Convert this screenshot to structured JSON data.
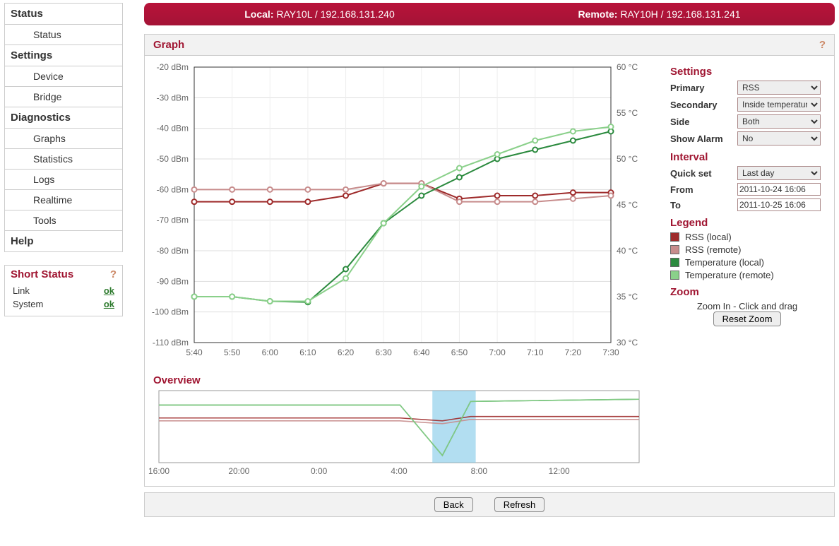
{
  "header": {
    "local_label": "Local:",
    "local_value": "RAY10L / 192.168.131.240",
    "remote_label": "Remote:",
    "remote_value": "RAY10H / 192.168.131.241"
  },
  "menu": {
    "groups": [
      {
        "title": "Status",
        "items": [
          "Status"
        ]
      },
      {
        "title": "Settings",
        "items": [
          "Device",
          "Bridge"
        ]
      },
      {
        "title": "Diagnostics",
        "items": [
          "Graphs",
          "Statistics",
          "Logs",
          "Realtime",
          "Tools"
        ]
      },
      {
        "title": "Help",
        "items": []
      }
    ]
  },
  "short_status": {
    "title": "Short Status",
    "help": "?",
    "rows": [
      {
        "label": "Link",
        "value": "ok"
      },
      {
        "label": "System",
        "value": "ok"
      }
    ]
  },
  "panel": {
    "title": "Graph",
    "help": "?"
  },
  "overview": {
    "title": "Overview"
  },
  "settings": {
    "title": "Settings",
    "primary": {
      "label": "Primary",
      "value": "RSS"
    },
    "secondary": {
      "label": "Secondary",
      "value": "Inside temperature"
    },
    "side": {
      "label": "Side",
      "value": "Both"
    },
    "alarm": {
      "label": "Show Alarm",
      "value": "No"
    }
  },
  "interval": {
    "title": "Interval",
    "quickset": {
      "label": "Quick set",
      "value": "Last day"
    },
    "from": {
      "label": "From",
      "value": "2011-10-24 16:06"
    },
    "to": {
      "label": "To",
      "value": "2011-10-25 16:06"
    }
  },
  "legend": {
    "title": "Legend",
    "items": [
      {
        "label": "RSS (local)",
        "color": "#9e2b2b"
      },
      {
        "label": "RSS (remote)",
        "color": "#c78c8c"
      },
      {
        "label": "Temperature (local)",
        "color": "#2b8a3e"
      },
      {
        "label": "Temperature (remote)",
        "color": "#8ad08a"
      }
    ]
  },
  "zoom": {
    "title": "Zoom",
    "hint": "Zoom In - Click and drag",
    "reset": "Reset Zoom"
  },
  "footer": {
    "back": "Back",
    "refresh": "Refresh"
  },
  "chart_data": {
    "type": "line",
    "title": "",
    "x": [
      "5:40",
      "5:50",
      "6:00",
      "6:10",
      "6:20",
      "6:30",
      "6:40",
      "6:50",
      "7:00",
      "7:10",
      "7:20",
      "7:30"
    ],
    "y1": {
      "label": "dBm",
      "min": -110,
      "max": -20,
      "ticks": [
        -20,
        -30,
        -40,
        -50,
        -60,
        -70,
        -80,
        -90,
        -100,
        -110
      ]
    },
    "y2": {
      "label": "°C",
      "min": 30,
      "max": 60,
      "ticks": [
        60,
        55,
        50,
        45,
        40,
        35,
        30
      ]
    },
    "series": [
      {
        "name": "RSS (local)",
        "axis": "y1",
        "color": "#9e2b2b",
        "values": [
          -64,
          -64,
          -64,
          -64,
          -62,
          -58,
          -58,
          -63,
          -62,
          -62,
          -61,
          -61
        ]
      },
      {
        "name": "RSS (remote)",
        "axis": "y1",
        "color": "#c78c8c",
        "values": [
          -60,
          -60,
          -60,
          -60,
          -60,
          -58,
          -58,
          -64,
          -64,
          -64,
          -63,
          -62
        ]
      },
      {
        "name": "Temperature (local)",
        "axis": "y2",
        "color": "#2b8a3e",
        "values": [
          35,
          35,
          34.5,
          34.4,
          38,
          43,
          46,
          48,
          50,
          51,
          52,
          53
        ]
      },
      {
        "name": "Temperature (remote)",
        "axis": "y2",
        "color": "#8ad08a",
        "values": [
          35,
          35,
          34.5,
          34.5,
          37,
          43,
          47,
          49,
          50.5,
          52,
          53,
          53.5
        ]
      }
    ],
    "overview": {
      "x_ticks": [
        "20:00",
        "0:00",
        "4:00",
        "8:00",
        "12:00",
        "16:00"
      ],
      "selection": [
        "5:40",
        "7:50"
      ]
    }
  }
}
